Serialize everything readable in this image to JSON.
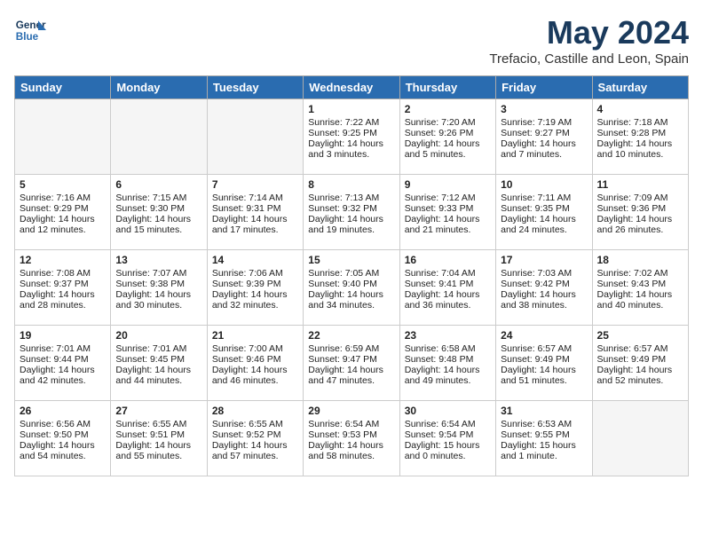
{
  "header": {
    "logo_line1": "General",
    "logo_line2": "Blue",
    "month": "May 2024",
    "location": "Trefacio, Castille and Leon, Spain"
  },
  "days_of_week": [
    "Sunday",
    "Monday",
    "Tuesday",
    "Wednesday",
    "Thursday",
    "Friday",
    "Saturday"
  ],
  "weeks": [
    [
      {
        "day": "",
        "empty": true
      },
      {
        "day": "",
        "empty": true
      },
      {
        "day": "",
        "empty": true
      },
      {
        "day": "1",
        "sunrise": "7:22 AM",
        "sunset": "9:25 PM",
        "daylight": "14 hours and 3 minutes."
      },
      {
        "day": "2",
        "sunrise": "7:20 AM",
        "sunset": "9:26 PM",
        "daylight": "14 hours and 5 minutes."
      },
      {
        "day": "3",
        "sunrise": "7:19 AM",
        "sunset": "9:27 PM",
        "daylight": "14 hours and 7 minutes."
      },
      {
        "day": "4",
        "sunrise": "7:18 AM",
        "sunset": "9:28 PM",
        "daylight": "14 hours and 10 minutes."
      }
    ],
    [
      {
        "day": "5",
        "sunrise": "7:16 AM",
        "sunset": "9:29 PM",
        "daylight": "14 hours and 12 minutes."
      },
      {
        "day": "6",
        "sunrise": "7:15 AM",
        "sunset": "9:30 PM",
        "daylight": "14 hours and 15 minutes."
      },
      {
        "day": "7",
        "sunrise": "7:14 AM",
        "sunset": "9:31 PM",
        "daylight": "14 hours and 17 minutes."
      },
      {
        "day": "8",
        "sunrise": "7:13 AM",
        "sunset": "9:32 PM",
        "daylight": "14 hours and 19 minutes."
      },
      {
        "day": "9",
        "sunrise": "7:12 AM",
        "sunset": "9:33 PM",
        "daylight": "14 hours and 21 minutes."
      },
      {
        "day": "10",
        "sunrise": "7:11 AM",
        "sunset": "9:35 PM",
        "daylight": "14 hours and 24 minutes."
      },
      {
        "day": "11",
        "sunrise": "7:09 AM",
        "sunset": "9:36 PM",
        "daylight": "14 hours and 26 minutes."
      }
    ],
    [
      {
        "day": "12",
        "sunrise": "7:08 AM",
        "sunset": "9:37 PM",
        "daylight": "14 hours and 28 minutes."
      },
      {
        "day": "13",
        "sunrise": "7:07 AM",
        "sunset": "9:38 PM",
        "daylight": "14 hours and 30 minutes."
      },
      {
        "day": "14",
        "sunrise": "7:06 AM",
        "sunset": "9:39 PM",
        "daylight": "14 hours and 32 minutes."
      },
      {
        "day": "15",
        "sunrise": "7:05 AM",
        "sunset": "9:40 PM",
        "daylight": "14 hours and 34 minutes."
      },
      {
        "day": "16",
        "sunrise": "7:04 AM",
        "sunset": "9:41 PM",
        "daylight": "14 hours and 36 minutes."
      },
      {
        "day": "17",
        "sunrise": "7:03 AM",
        "sunset": "9:42 PM",
        "daylight": "14 hours and 38 minutes."
      },
      {
        "day": "18",
        "sunrise": "7:02 AM",
        "sunset": "9:43 PM",
        "daylight": "14 hours and 40 minutes."
      }
    ],
    [
      {
        "day": "19",
        "sunrise": "7:01 AM",
        "sunset": "9:44 PM",
        "daylight": "14 hours and 42 minutes."
      },
      {
        "day": "20",
        "sunrise": "7:01 AM",
        "sunset": "9:45 PM",
        "daylight": "14 hours and 44 minutes."
      },
      {
        "day": "21",
        "sunrise": "7:00 AM",
        "sunset": "9:46 PM",
        "daylight": "14 hours and 46 minutes."
      },
      {
        "day": "22",
        "sunrise": "6:59 AM",
        "sunset": "9:47 PM",
        "daylight": "14 hours and 47 minutes."
      },
      {
        "day": "23",
        "sunrise": "6:58 AM",
        "sunset": "9:48 PM",
        "daylight": "14 hours and 49 minutes."
      },
      {
        "day": "24",
        "sunrise": "6:57 AM",
        "sunset": "9:49 PM",
        "daylight": "14 hours and 51 minutes."
      },
      {
        "day": "25",
        "sunrise": "6:57 AM",
        "sunset": "9:49 PM",
        "daylight": "14 hours and 52 minutes."
      }
    ],
    [
      {
        "day": "26",
        "sunrise": "6:56 AM",
        "sunset": "9:50 PM",
        "daylight": "14 hours and 54 minutes."
      },
      {
        "day": "27",
        "sunrise": "6:55 AM",
        "sunset": "9:51 PM",
        "daylight": "14 hours and 55 minutes."
      },
      {
        "day": "28",
        "sunrise": "6:55 AM",
        "sunset": "9:52 PM",
        "daylight": "14 hours and 57 minutes."
      },
      {
        "day": "29",
        "sunrise": "6:54 AM",
        "sunset": "9:53 PM",
        "daylight": "14 hours and 58 minutes."
      },
      {
        "day": "30",
        "sunrise": "6:54 AM",
        "sunset": "9:54 PM",
        "daylight": "15 hours and 0 minutes."
      },
      {
        "day": "31",
        "sunrise": "6:53 AM",
        "sunset": "9:55 PM",
        "daylight": "15 hours and 1 minute."
      },
      {
        "day": "",
        "empty": true
      }
    ]
  ]
}
